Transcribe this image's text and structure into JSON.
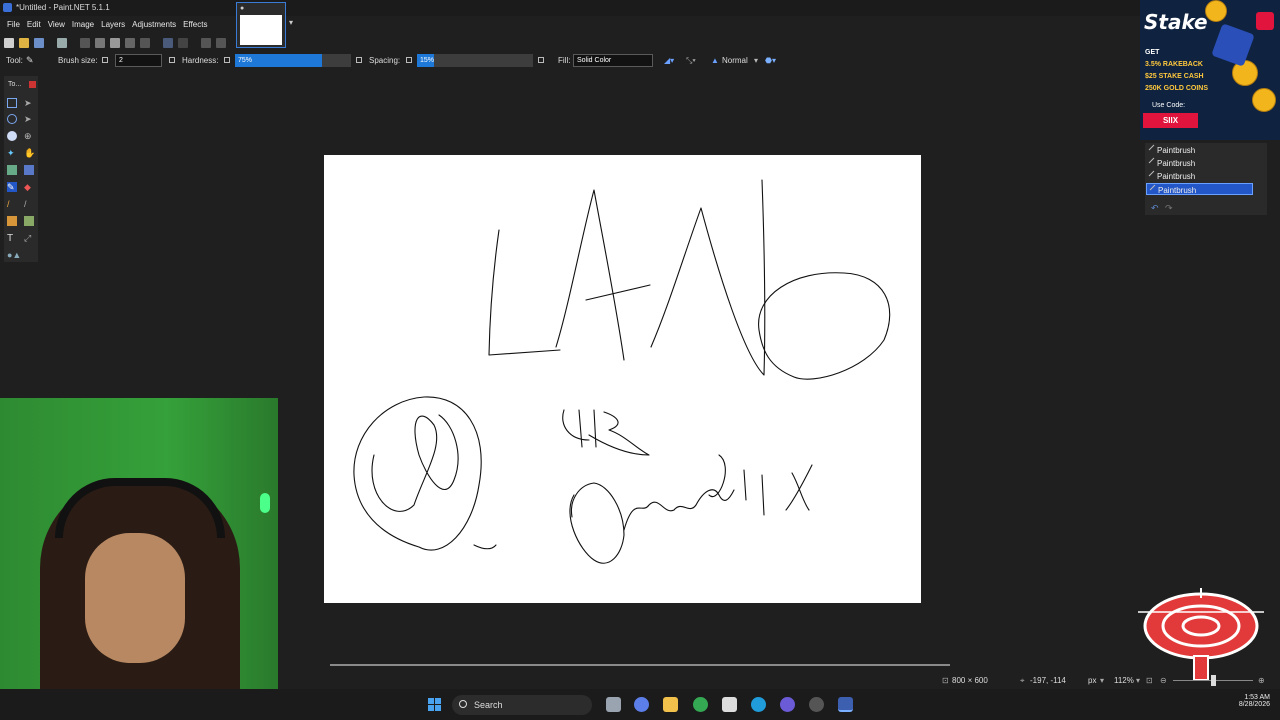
{
  "window": {
    "title": "*Untitled - Paint.NET 5.1.1"
  },
  "menu": {
    "items": [
      "File",
      "Edit",
      "View",
      "Image",
      "Layers",
      "Adjustments",
      "Effects"
    ]
  },
  "tool_options": {
    "tool_label": "Tool:",
    "brush_size_label": "Brush size:",
    "brush_size_value": "2",
    "hardness_label": "Hardness:",
    "hardness_value": "75%",
    "hardness_fraction": 0.75,
    "spacing_label": "Spacing:",
    "spacing_value": "15%",
    "spacing_fraction": 0.15,
    "fill_label": "Fill:",
    "fill_value": "Solid Color",
    "blend_mode": "Normal"
  },
  "tools_panel": {
    "title": "To..."
  },
  "history": {
    "items": [
      "Paintbrush",
      "Paintbrush",
      "Paintbrush",
      "Paintbrush"
    ],
    "selected_index": 3
  },
  "ad": {
    "brand": "Stake",
    "lines": [
      "GET",
      "3.5% RAKEBACK",
      "$25 STAKE CASH",
      "250K GOLD COINS"
    ],
    "code_label": "Use Code:",
    "code": "SIIX",
    "colors": {
      "bg": "#0f2340",
      "code_bg": "#e0143c",
      "gold": "#ffc83d"
    }
  },
  "status": {
    "image_size": "800 × 600",
    "cursor_pos": "-197, -114",
    "units": "px",
    "zoom": "112%"
  },
  "taskbar": {
    "search_label": "Search",
    "time": "1:53 AM",
    "date": "8/28/2026"
  },
  "icons": [
    "windows-start-icon",
    "search-icon",
    "paintbrush-icon",
    "undo-icon",
    "redo-icon",
    "close-icon"
  ],
  "colors": {
    "accent": "#1e78d7",
    "history_selected": "#2356c6",
    "canvas": "#ffffff",
    "app_bg": "#1f1f1f"
  }
}
